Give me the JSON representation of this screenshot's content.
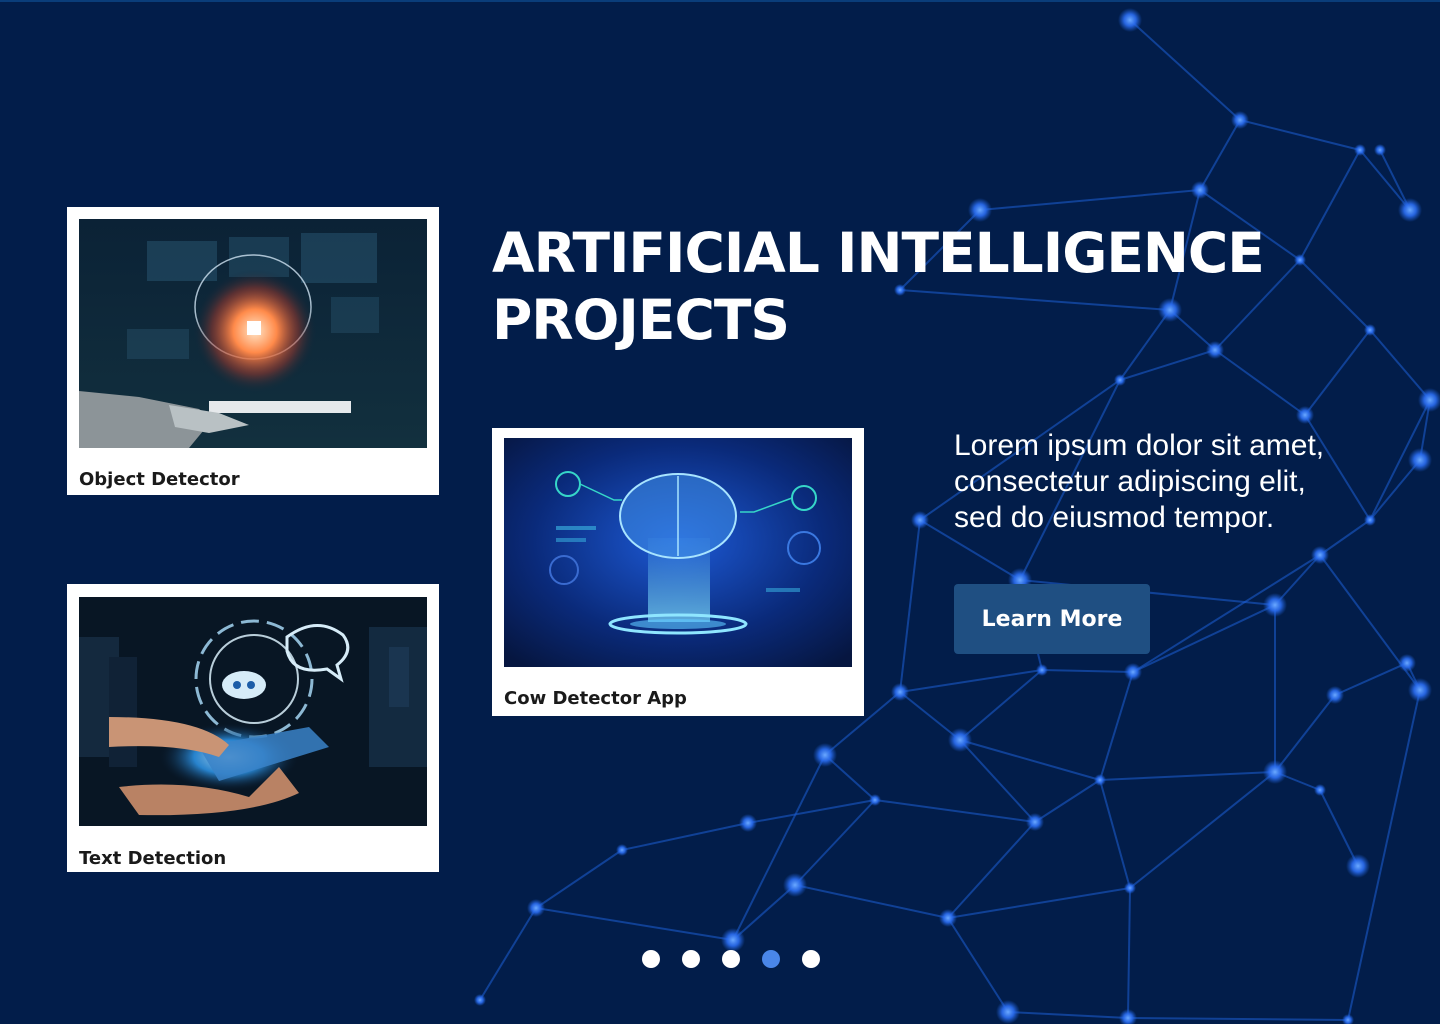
{
  "hero": {
    "title_lines": [
      "ARTIFICIAL INTELLIGENCE",
      "PROJECTS"
    ],
    "description_lines": [
      "Lorem ipsum dolor sit amet,",
      "consectetur adipiscing elit,",
      "sed do eiusmod tempor."
    ],
    "cta_label": "Learn More"
  },
  "projects": [
    {
      "caption": "Object Detector",
      "image": "ai-brain-robot-hand"
    },
    {
      "caption": "Text Detection",
      "image": "chatbot-smartphone"
    },
    {
      "caption": "Cow Detector App",
      "image": "digital-brain-hologram"
    }
  ],
  "carousel": {
    "total_slides": 5,
    "active_slide": 4
  },
  "colors": {
    "background": "#021d4a",
    "button": "#1f4f82",
    "network_lines": "#1e5fd6",
    "active_dot": "#4a86e8"
  }
}
